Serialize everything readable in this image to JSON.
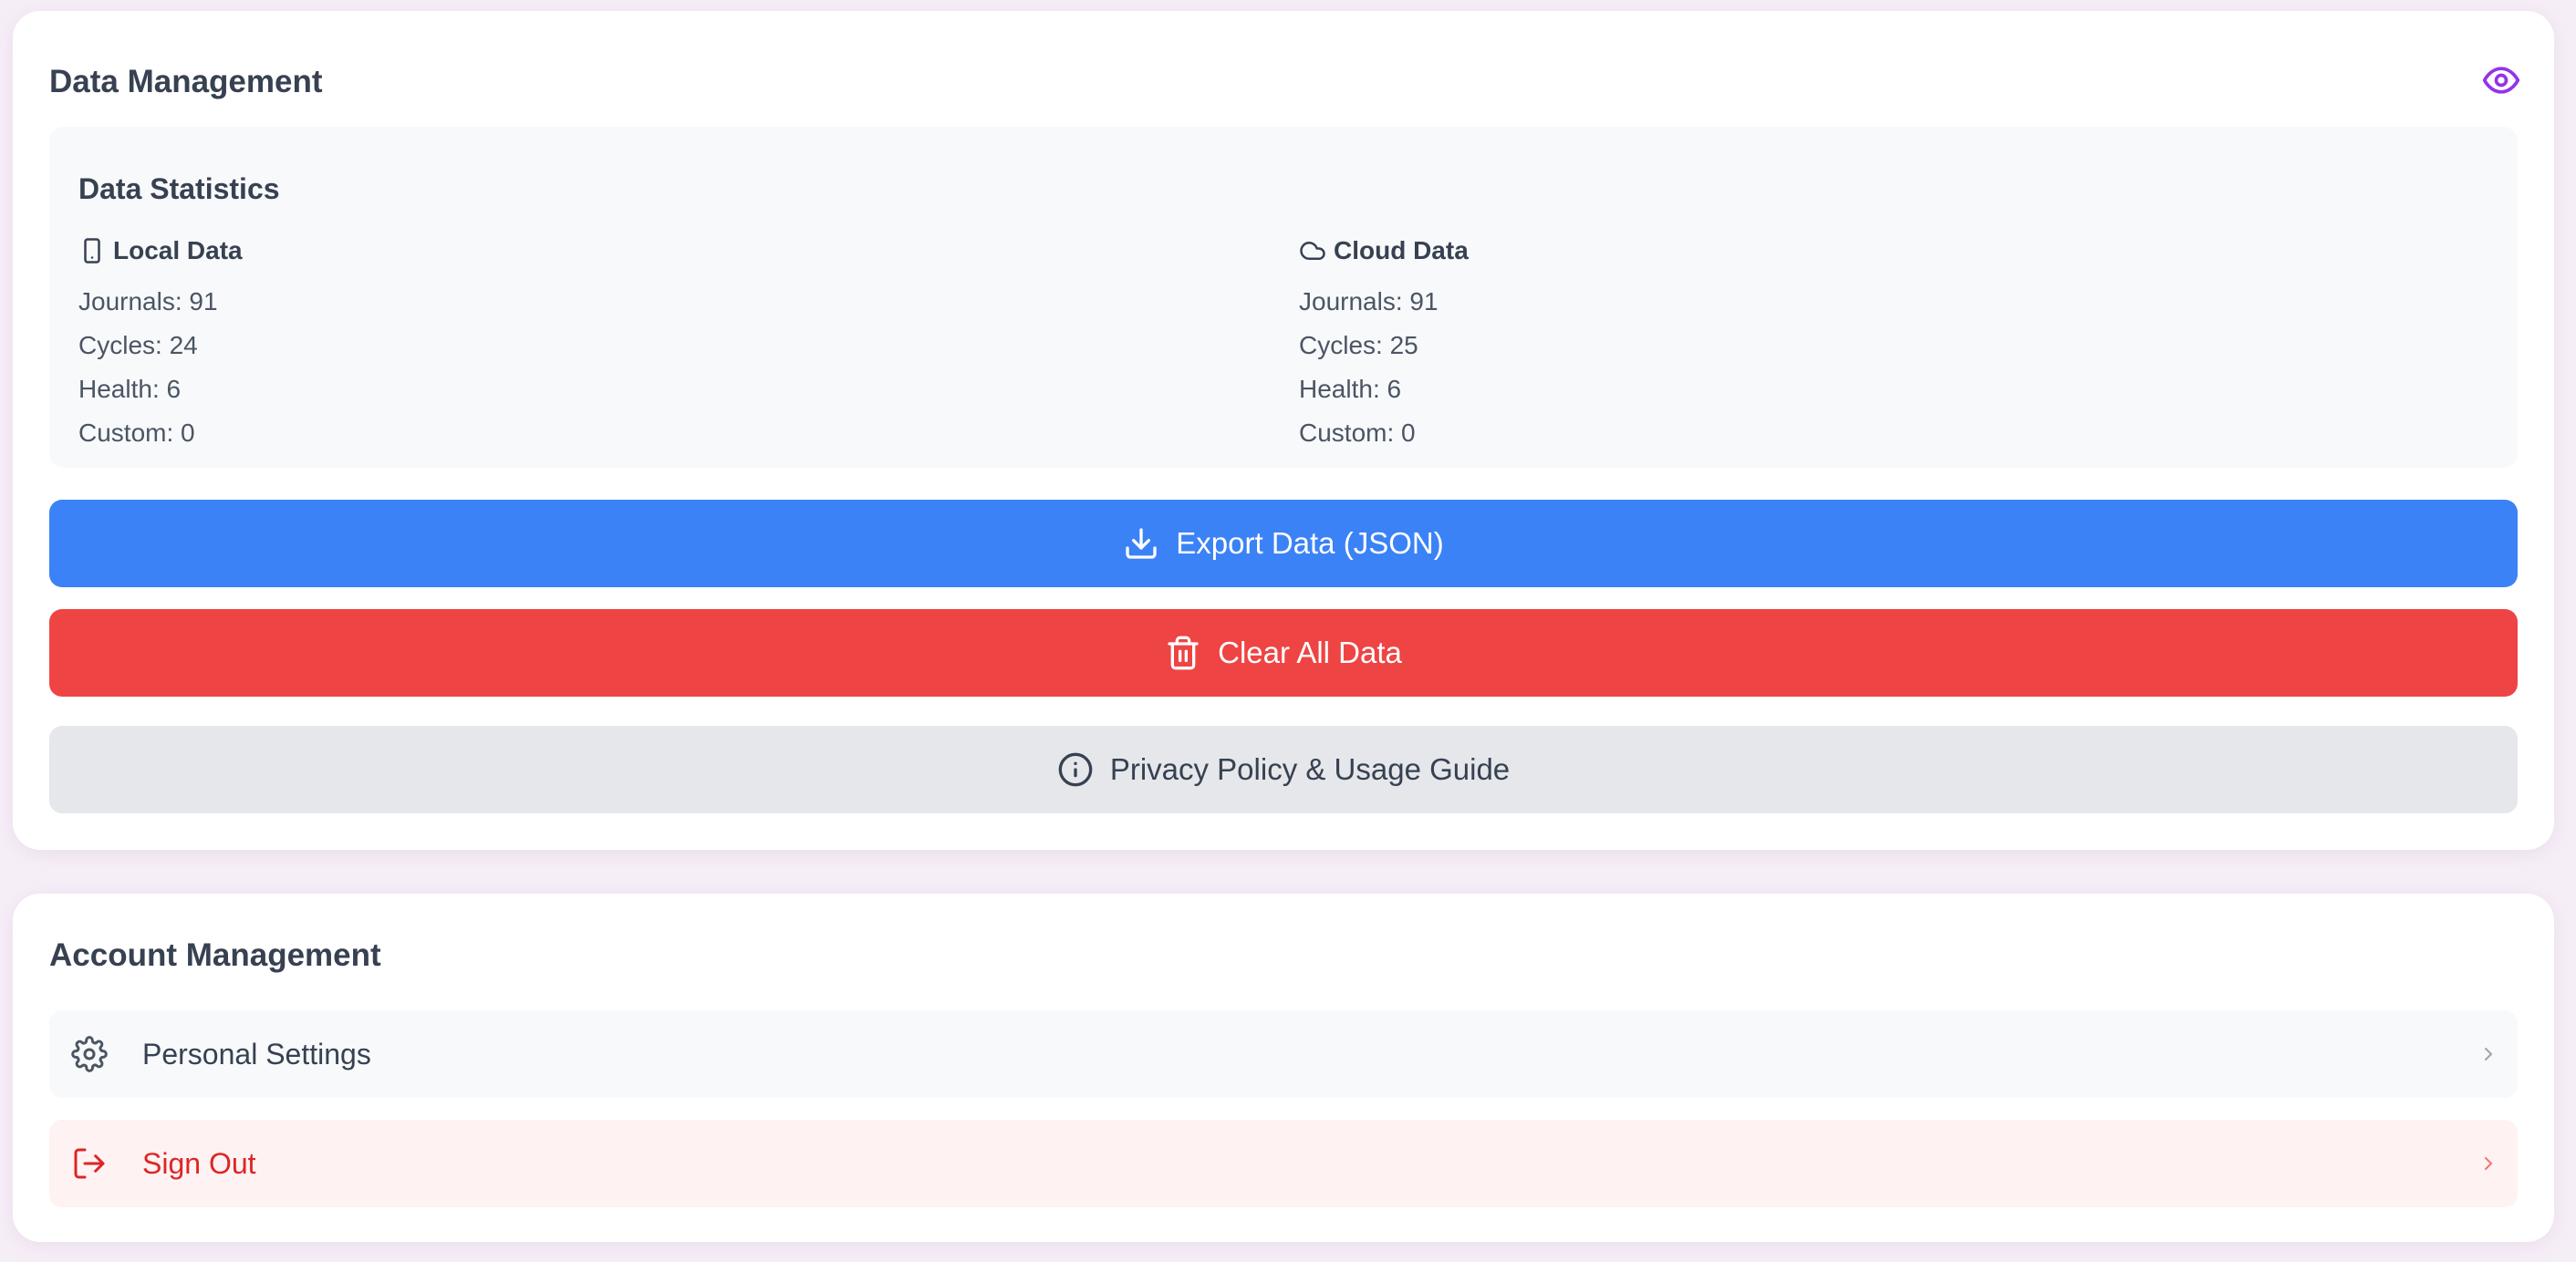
{
  "data_management": {
    "title": "Data Management",
    "visibility_icon": "eye-icon",
    "stats": {
      "title": "Data Statistics",
      "local": {
        "heading": "Local Data",
        "icon": "phone-icon",
        "lines": [
          "Journals: 91",
          "Cycles: 24",
          "Health: 6",
          "Custom: 0"
        ]
      },
      "cloud": {
        "heading": "Cloud Data",
        "icon": "cloud-icon",
        "lines": [
          "Journals: 91",
          "Cycles: 25",
          "Health: 6",
          "Custom: 0"
        ]
      }
    },
    "buttons": {
      "export": {
        "label": "Export Data (JSON)",
        "icon": "download-icon",
        "color": "#3b82f6"
      },
      "clear": {
        "label": "Clear All Data",
        "icon": "trash-icon",
        "color": "#ef4444"
      },
      "privacy": {
        "label": "Privacy Policy & Usage Guide",
        "icon": "info-icon",
        "color": "#e5e7eb"
      }
    }
  },
  "account_management": {
    "title": "Account Management",
    "items": [
      {
        "label": "Personal Settings",
        "icon": "gear-icon"
      },
      {
        "label": "Sign Out",
        "icon": "sign-out-icon",
        "color": "#dc2626"
      }
    ]
  },
  "colors": {
    "accent_purple": "#9333ea",
    "background": "#f6eef7"
  }
}
